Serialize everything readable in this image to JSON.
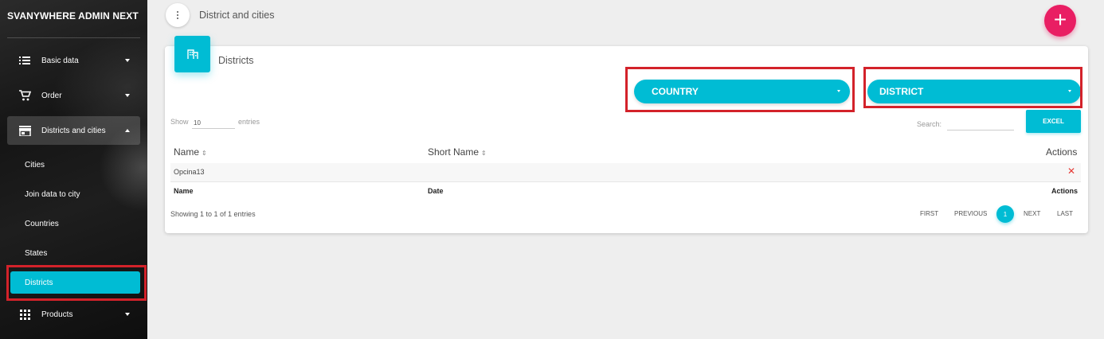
{
  "app": {
    "title": "SVANYWHERE ADMIN NEXT"
  },
  "sidebar": {
    "items": [
      {
        "label": "Basic data",
        "icon": "list-icon"
      },
      {
        "label": "Order",
        "icon": "cart-icon"
      },
      {
        "label": "Districts and cities",
        "icon": "store-icon"
      }
    ],
    "subitems": [
      "Cities",
      "Join data to city",
      "Countries",
      "States",
      "Districts"
    ],
    "active_subitem": "Districts",
    "products": {
      "label": "Products",
      "icon": "grid-icon"
    }
  },
  "header": {
    "title": "District and cities",
    "fab": "+"
  },
  "card": {
    "title": "Districts",
    "icon": "building-icon",
    "country_dropdown": "COUNTRY",
    "district_dropdown": "DISTRICT",
    "show_label": "Show",
    "show_value": "10",
    "entries_label": "entries",
    "search_label": "Search:",
    "excel_label": "EXCEL"
  },
  "table": {
    "columns": [
      "Name",
      "Short Name",
      "Actions"
    ],
    "rows": [
      {
        "name": "Opcina13",
        "short_name": ""
      }
    ],
    "footer": [
      "Name",
      "Date",
      "Actions"
    ]
  },
  "pagination": {
    "info": "Showing 1 to 1 of 1 entries",
    "first": "FIRST",
    "previous": "PREVIOUS",
    "current": "1",
    "next": "NEXT",
    "last": "LAST"
  },
  "colors": {
    "accent": "#00bcd4",
    "fab": "#e91e63",
    "highlight": "#d3222a",
    "delete": "#e53935"
  }
}
